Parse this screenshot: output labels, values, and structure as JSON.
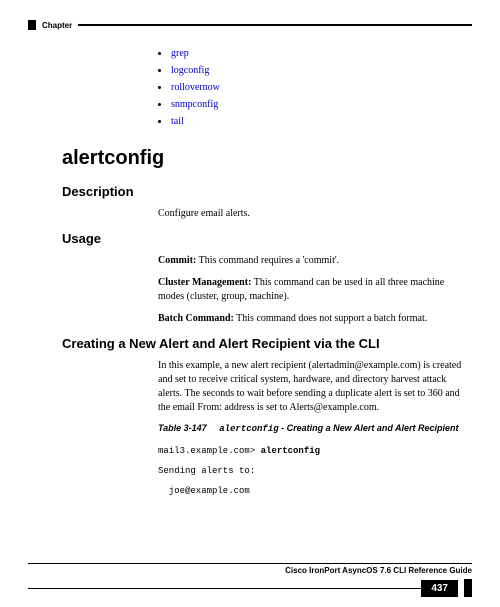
{
  "header": {
    "label": "Chapter"
  },
  "bullets": {
    "items": [
      {
        "label": "grep"
      },
      {
        "label": "logconfig"
      },
      {
        "label": "rollovernow"
      },
      {
        "label": "snmpconfig"
      },
      {
        "label": "tail"
      }
    ]
  },
  "h1": "alertconfig",
  "desc": {
    "heading": "Description",
    "text": "Configure email alerts."
  },
  "usage": {
    "heading": "Usage",
    "commit_label": "Commit:",
    "commit_text": " This command requires a 'commit'.",
    "cluster_label": "Cluster Management:",
    "cluster_text": " This command can be used in all three machine modes (cluster, group, machine).",
    "batch_label": "Batch Command:",
    "batch_text": " This command does not support a batch format."
  },
  "section3": {
    "heading": "Creating a New Alert and Alert Recipient via the CLI",
    "para": "In this example, a new alert recipient (alertadmin@example.com) is created and set to receive critical system, hardware, and directory harvest attack alerts. The seconds to wait before sending a duplicate alert is set to 360 and the email From: address is set to Alerts@example.com.",
    "table_num": "Table 3-147",
    "table_cmd": "alertconfig",
    "table_desc": " - Creating a New Alert and Alert Recipient",
    "code_prompt": "mail3.example.com> ",
    "code_cmd": "alertconfig",
    "code_line2": "Sending alerts to:",
    "code_line3": "  joe@example.com"
  },
  "footer": {
    "title": "Cisco IronPort AsyncOS 7.6 CLI Reference Guide",
    "page": "437"
  }
}
